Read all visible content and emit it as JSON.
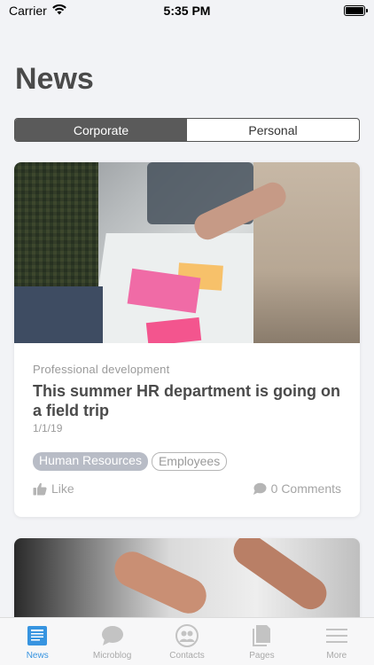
{
  "status_bar": {
    "carrier": "Carrier",
    "time": "5:35 PM"
  },
  "page": {
    "title": "News"
  },
  "segments": {
    "corporate": "Corporate",
    "personal": "Personal",
    "active": "corporate"
  },
  "news_items": [
    {
      "category": "Professional development",
      "headline": "This summer HR department is going on a field trip",
      "date": "1/1/19",
      "tags": [
        "Human Resources",
        "Employees"
      ],
      "like_label": "Like",
      "comments_label": "0 Comments"
    }
  ],
  "tab_bar": {
    "items": [
      {
        "label": "News",
        "icon": "news-icon",
        "active": true
      },
      {
        "label": "Microblog",
        "icon": "speech-bubble-icon",
        "active": false
      },
      {
        "label": "Contacts",
        "icon": "contacts-icon",
        "active": false
      },
      {
        "label": "Pages",
        "icon": "pages-icon",
        "active": false
      },
      {
        "label": "More",
        "icon": "menu-icon",
        "active": false
      }
    ]
  },
  "colors": {
    "accent": "#3794e0",
    "background": "#f2f3f6",
    "segment_active": "#5a5a5a",
    "tag_filled": "#b8bcc6"
  }
}
